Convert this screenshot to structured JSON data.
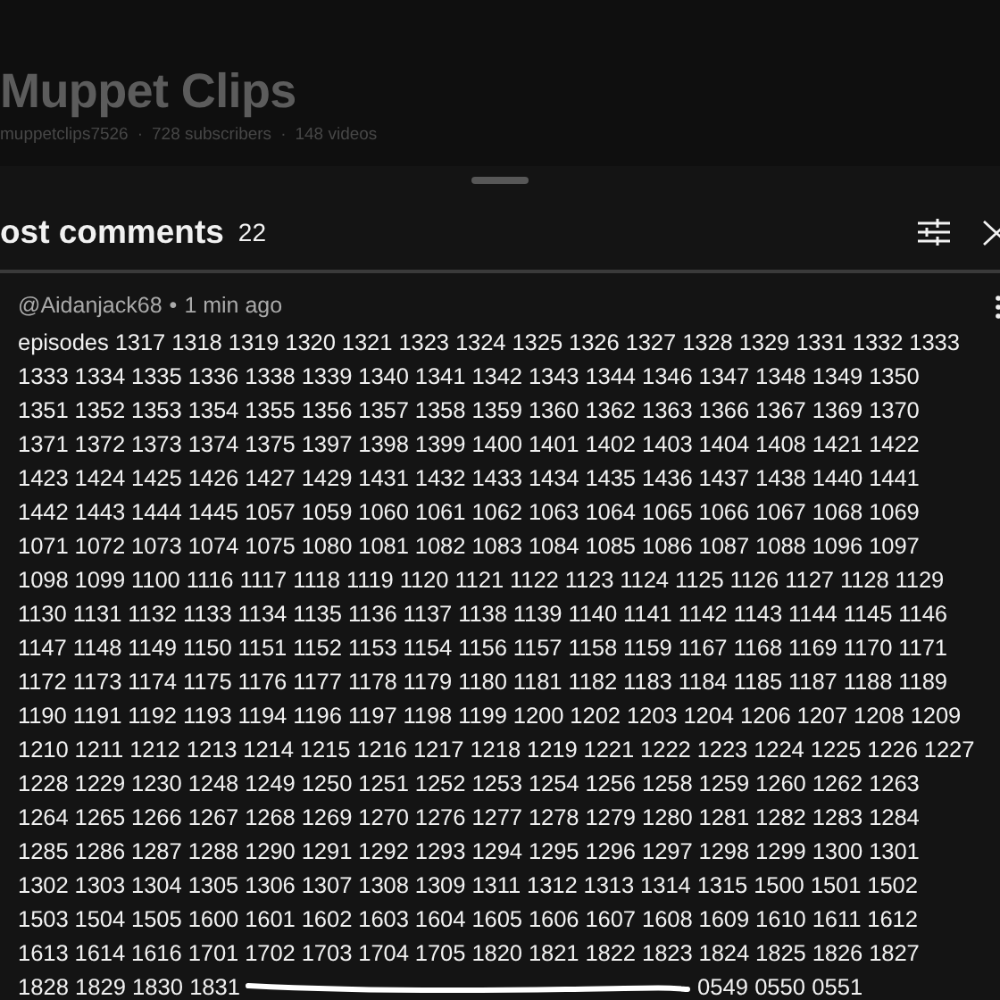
{
  "channel": {
    "title": "Muppet Clips",
    "handle": "muppetclips7526",
    "subscribers": "728 subscribers",
    "videos": "148 videos",
    "separator": "·"
  },
  "comments_panel": {
    "title": "ost comments",
    "count": "22"
  },
  "comment": {
    "author": "@Aidanjack68",
    "time": "1 min ago",
    "separator": "•",
    "lines": [
      "episodes 1317 1318 1319 1320 1321 1323 1324 1325 1326 1327 1328 1329 1331 1332 1333",
      "1333 1334 1335 1336 1338 1339 1340 1341 1342 1343 1344 1346 1347 1348 1349 1350",
      "1351 1352 1353 1354 1355 1356 1357 1358 1359 1360 1362 1363 1366 1367 1369 1370",
      "1371 1372 1373 1374 1375 1397 1398 1399 1400 1401 1402 1403 1404 1408 1421 1422",
      "1423 1424 1425 1426 1427 1429 1431 1432 1433 1434 1435 1436 1437 1438 1440 1441",
      "1442 1443 1444 1445 1057 1059 1060 1061 1062 1063 1064 1065 1066 1067 1068 1069",
      "1071 1072 1073 1074 1075 1080 1081 1082 1083 1084 1085 1086 1087 1088 1096 1097",
      "1098 1099 1100 1116 1117 1118 1119 1120 1121 1122 1123 1124 1125 1126 1127 1128 1129",
      "1130 1131 1132 1133 1134 1135 1136 1137 1138 1139 1140 1141 1142 1143 1144 1145 1146",
      "1147 1148 1149 1150 1151 1152 1153 1154 1156 1157 1158 1159 1167 1168 1169 1170 1171",
      "1172 1173 1174 1175 1176 1177 1178 1179 1180 1181 1182 1183 1184 1185 1187 1188 1189",
      "1190 1191 1192 1193 1194 1196 1197 1198 1199 1200 1202 1203 1204 1206 1207 1208 1209",
      "1210 1211 1212 1213 1214 1215 1216 1217 1218 1219 1221 1222 1223 1224 1225 1226 1227",
      "1228 1229 1230 1248 1249 1250 1251 1252 1253 1254 1256 1258 1259 1260 1262 1263",
      "1264 1265 1266 1267 1268 1269 1270 1276 1277 1278 1279 1280 1281 1282 1283 1284",
      "1285 1286 1287 1288 1290 1291 1292 1293 1294 1295 1296 1297 1298 1299 1300 1301",
      "1302 1303 1304 1305 1306 1307 1308 1309 1311 1312 1313 1314 1315 1500 1501 1502",
      "1503 1504 1505 1600 1601 1602 1603 1604 1605 1606 1607 1608 1609 1610 1611 1612",
      "1613 1614 1616 1701 1702 1703 1704 1705 1820 1821 1822 1823 1824 1825 1826 1827"
    ],
    "last_line_before_mark": "1828 1829 1830 1831",
    "last_line_after_mark": "0549 0550 0551"
  }
}
